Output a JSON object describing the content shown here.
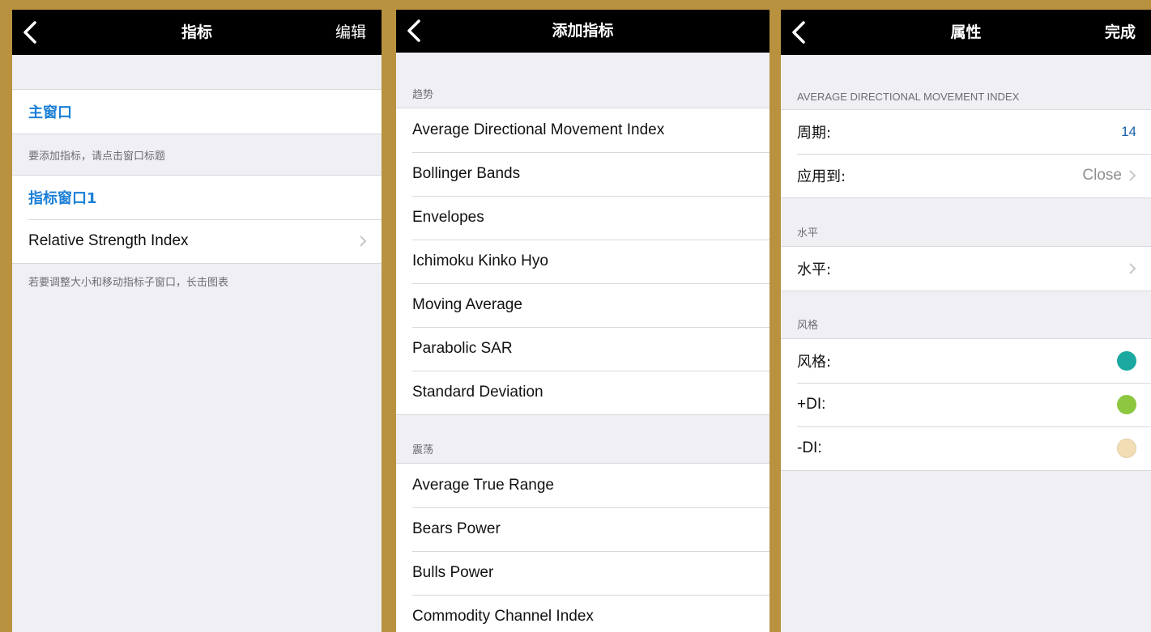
{
  "screen1": {
    "title": "指标",
    "edit": "编辑",
    "main_window": "主窗口",
    "main_hint": "要添加指标，请点击窗口标题",
    "indicator_window": "指标窗口1",
    "indicator_item": "Relative Strength Index",
    "footer_hint": "若要调整大小和移动指标子窗口，长击图表"
  },
  "screen2": {
    "title": "添加指标",
    "sections": [
      {
        "header": "趋势",
        "items": [
          "Average Directional Movement Index",
          "Bollinger Bands",
          "Envelopes",
          "Ichimoku Kinko Hyo",
          "Moving Average",
          "Parabolic SAR",
          "Standard Deviation"
        ]
      },
      {
        "header": "震荡",
        "items": [
          "Average True Range",
          "Bears Power",
          "Bulls Power",
          "Commodity Channel Index"
        ]
      }
    ]
  },
  "screen3": {
    "title": "属性",
    "done": "完成",
    "section_params": "AVERAGE DIRECTIONAL MOVEMENT INDEX",
    "period_label": "周期:",
    "period_value": "14",
    "apply_label": "应用到:",
    "apply_value": "Close",
    "section_levels": "水平",
    "levels_label": "水平:",
    "section_style": "风格",
    "style_label": "风格:",
    "plus_di_label": "+DI:",
    "minus_di_label": "-DI:",
    "colors": {
      "style": "#1AA8A0",
      "plus_di": "#8DC63F",
      "minus_di": "#F2DDB5"
    }
  }
}
